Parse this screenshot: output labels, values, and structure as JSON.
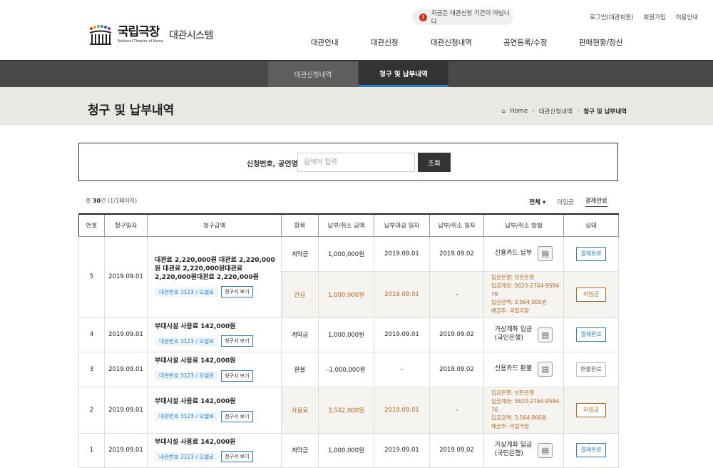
{
  "header": {
    "logo_ko": "국립극장",
    "logo_en": "National Theater of Korea",
    "system_name": "대관시스템",
    "notice": "지금은 대관신청 기간이 아닙니다",
    "util": [
      "로그인(대관회원)",
      "회원가입",
      "이용안내"
    ],
    "gnb": [
      "대관안내",
      "대관신청",
      "대관신청내역",
      "공연등록/수정",
      "판매현황/정산"
    ]
  },
  "subnav": {
    "tabs": [
      "대관신청내역",
      "청구 및 납부내역"
    ],
    "active": 1
  },
  "page": {
    "title": "청구 및 납부내역",
    "breadcrumb": [
      "Home",
      "대관신청내역",
      "청구 및 납부내역"
    ]
  },
  "search": {
    "label": "신청번호, 공연명",
    "placeholder": "검색어 입력",
    "button": "조회"
  },
  "summary": {
    "prefix": "총",
    "count": "30",
    "suffix": "건 (1/1페이지)"
  },
  "filters": {
    "all": "전체",
    "unpaid": "미입금",
    "paid": "결제완료"
  },
  "table": {
    "headers": [
      "번호",
      "청구일자",
      "청구금액",
      "항목",
      "납부/취소 금액",
      "납부마감 일자",
      "납부/취소 일자",
      "납부/취소 방법",
      "상태"
    ],
    "link_label": "대관번호 3123 / 오셀로",
    "view_label": "청구서 보기",
    "rows": [
      {
        "no": "5",
        "date": "2019.09.01",
        "amount": "대관료 2,220,000원 대관료 2,220,000원 대관료 2,220,000원대관료 2,220,000원대관료 2,220,000원",
        "sub": [
          {
            "item": "계약금",
            "pay": "1,000,000원",
            "due": "2019.09.01",
            "paid": "2019.09.02",
            "method": "신용카드 납부",
            "status": "결제완료"
          },
          {
            "item": "잔금",
            "pay": "1,000,000원",
            "due": "2019.09.01",
            "paid": "-",
            "bank": [
              "입금은행: 신한은행",
              "입금계좌: 5620-2764-9584-76",
              "입금금액: 3,564,000원",
              "예금주: 국립극장"
            ],
            "status": "미입금"
          }
        ]
      },
      {
        "no": "4",
        "date": "2019.09.01",
        "amount": "부대시설 사용료 142,000원",
        "item": "계약금",
        "pay": "1,000,000원",
        "due": "2019.09.01",
        "paid": "2019.09.02",
        "method": [
          "가상계좌 입금",
          "(국민은행)"
        ],
        "status": "결제완료"
      },
      {
        "no": "3",
        "date": "2019.09.01",
        "amount": "부대시설 사용료 142,000원",
        "item": "환불",
        "pay": "-1,000,000원",
        "due": "-",
        "paid": "2019.09.02",
        "method": "신용카드 환불",
        "status": "환불완료"
      },
      {
        "no": "2",
        "date": "2019.09.01",
        "amount": "부대시설 사용료 142,000원",
        "item": "사용료",
        "pay": "3,542,000원",
        "due": "2019.09.01",
        "paid": "-",
        "bank": [
          "입금은행: 신한은행",
          "입금계좌: 5620-2764-9584-76",
          "입금금액: 3,564,000원",
          "예금주: 국립극장"
        ],
        "status": "미입금"
      },
      {
        "no": "1",
        "date": "2019.09.01",
        "amount": "부대시설 사용료 142,000원",
        "item": "계약금",
        "pay": "1,000,000원",
        "due": "2019.09.01",
        "paid": "2019.09.02",
        "method": [
          "가상계좌 입금",
          "(국민은행)"
        ],
        "status": "결제완료"
      }
    ]
  },
  "colors": {
    "accent": "#2e7dc3",
    "unpaid": "#b5651d",
    "dark": "#333333"
  }
}
